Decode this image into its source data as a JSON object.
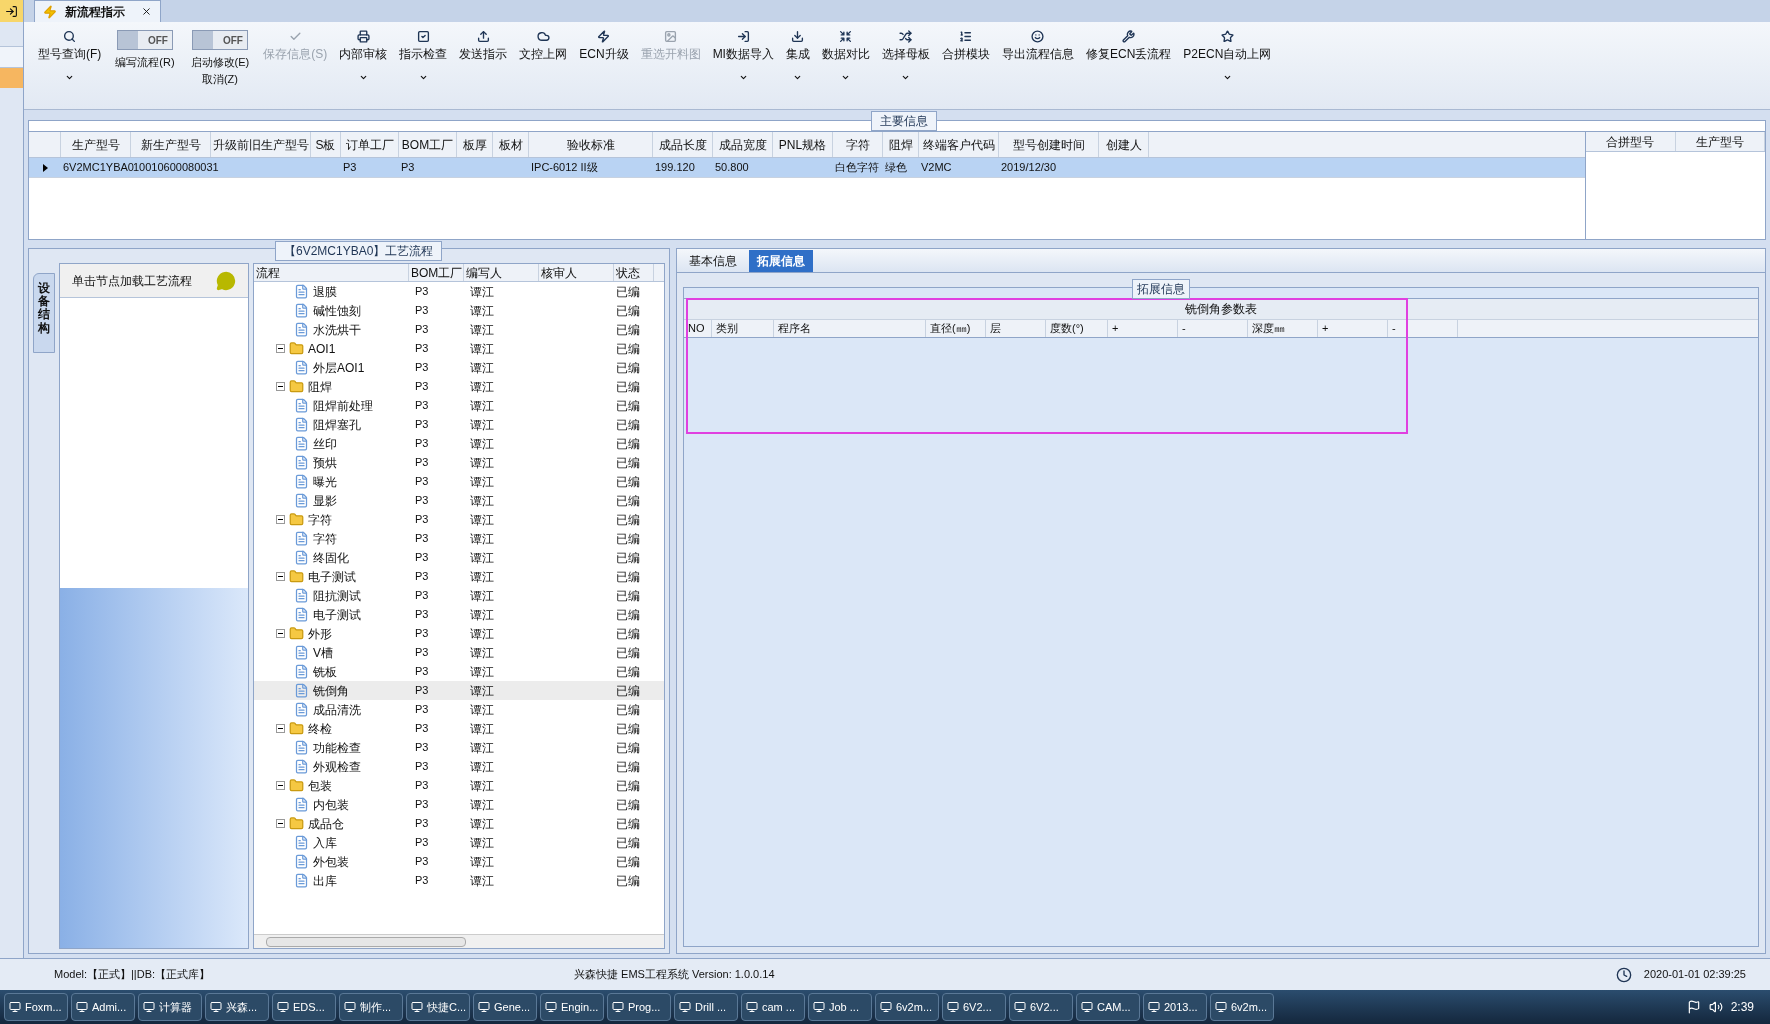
{
  "doc_tab": {
    "title": "新流程指示"
  },
  "toolbar": [
    {
      "kind": "button",
      "label": "型号查询(F)",
      "disabled": false,
      "dropdown": true
    },
    {
      "kind": "toggle",
      "label": "编写流程(R)",
      "switch_text": "OFF",
      "on": false
    },
    {
      "kind": "toggle",
      "label": "启动修改(E)",
      "sub_label": "取消(Z)",
      "switch_text": "OFF",
      "on": false
    },
    {
      "kind": "button",
      "label": "保存信息(S)",
      "disabled": true,
      "dropdown": false
    },
    {
      "kind": "button",
      "label": "内部审核",
      "disabled": false,
      "dropdown": true
    },
    {
      "kind": "button",
      "label": "指示检查",
      "disabled": false,
      "dropdown": true
    },
    {
      "kind": "button",
      "label": "发送指示",
      "disabled": false,
      "dropdown": false
    },
    {
      "kind": "button",
      "label": "文控上网",
      "disabled": false,
      "dropdown": false
    },
    {
      "kind": "button",
      "label": "ECN升级",
      "disabled": false,
      "dropdown": false
    },
    {
      "kind": "button",
      "label": "重选开料图",
      "disabled": true,
      "dropdown": false
    },
    {
      "kind": "button",
      "label": "MI数据导入",
      "disabled": false,
      "dropdown": true
    },
    {
      "kind": "button",
      "label": "集成",
      "disabled": false,
      "dropdown": true
    },
    {
      "kind": "button",
      "label": "数据对比",
      "disabled": false,
      "dropdown": true
    },
    {
      "kind": "button",
      "label": "选择母板",
      "disabled": false,
      "dropdown": true
    },
    {
      "kind": "button",
      "label": "合拼模块",
      "disabled": false,
      "dropdown": false
    },
    {
      "kind": "button",
      "label": "导出流程信息",
      "disabled": false,
      "dropdown": false
    },
    {
      "kind": "button",
      "label": "修复ECN丢流程",
      "disabled": false,
      "dropdown": false
    },
    {
      "kind": "button",
      "label": "P2ECN自动上网",
      "disabled": false,
      "dropdown": true
    }
  ],
  "main_info": {
    "title": "主要信息",
    "columns": [
      "生产型号",
      "新生产型号",
      "升级前旧生产型号",
      "S板",
      "订单工厂",
      "BOM工厂",
      "板厚",
      "板材",
      "验收标准",
      "成品长度",
      "成品宽度",
      "PNL规格",
      "字符",
      "阻焊",
      "终端客户代码",
      "型号创建时间",
      "创建人"
    ],
    "rows": [
      {
        "selected": true,
        "cells": [
          "6V2MC1YBA0",
          "10010600080031",
          "",
          "",
          "P3",
          "P3",
          "",
          "",
          "IPC-6012 II级",
          "199.120",
          "50.800",
          "",
          "白色字符",
          "绿色",
          "V2MC",
          "2019/12/30",
          ""
        ]
      }
    ],
    "side_columns": [
      "合拼型号",
      "生产型号"
    ]
  },
  "side_tab": {
    "label": "设备结构"
  },
  "node_panel": {
    "hint": "单击节点加载工艺流程"
  },
  "flow": {
    "title": "【6V2MC1YBA0】工艺流程",
    "columns": [
      "流程",
      "BOM工厂",
      "编写人",
      "核审人",
      "状态"
    ],
    "tree": [
      {
        "children": [
          {
            "label": "退膜",
            "bom": "P3",
            "writer": "谭江",
            "status": "已编",
            "selected": false
          },
          {
            "label": "碱性蚀刻",
            "bom": "P3",
            "writer": "谭江",
            "status": "已编",
            "selected": false
          },
          {
            "label": "水洗烘干",
            "bom": "P3",
            "writer": "谭江",
            "status": "已编",
            "selected": false
          }
        ]
      },
      {
        "label": "AOI1",
        "bom": "P3",
        "writer": "谭江",
        "status": "已编",
        "selected": false,
        "expanded": true,
        "children": [
          {
            "label": "外层AOI1",
            "bom": "P3",
            "writer": "谭江",
            "status": "已编",
            "selected": false
          }
        ]
      },
      {
        "label": "阻焊",
        "bom": "P3",
        "writer": "谭江",
        "status": "已编",
        "selected": false,
        "expanded": true,
        "children": [
          {
            "label": "阻焊前处理",
            "bom": "P3",
            "writer": "谭江",
            "status": "已编",
            "selected": false
          },
          {
            "label": "阻焊塞孔",
            "bom": "P3",
            "writer": "谭江",
            "status": "已编",
            "selected": false
          },
          {
            "label": "丝印",
            "bom": "P3",
            "writer": "谭江",
            "status": "已编",
            "selected": false
          },
          {
            "label": "预烘",
            "bom": "P3",
            "writer": "谭江",
            "status": "已编",
            "selected": false
          },
          {
            "label": "曝光",
            "bom": "P3",
            "writer": "谭江",
            "status": "已编",
            "selected": false
          },
          {
            "label": "显影",
            "bom": "P3",
            "writer": "谭江",
            "status": "已编",
            "selected": false
          }
        ]
      },
      {
        "label": "字符",
        "bom": "P3",
        "writer": "谭江",
        "status": "已编",
        "selected": false,
        "expanded": true,
        "children": [
          {
            "label": "字符",
            "bom": "P3",
            "writer": "谭江",
            "status": "已编",
            "selected": false
          },
          {
            "label": "终固化",
            "bom": "P3",
            "writer": "谭江",
            "status": "已编",
            "selected": false
          }
        ]
      },
      {
        "label": "电子测试",
        "bom": "P3",
        "writer": "谭江",
        "status": "已编",
        "selected": false,
        "expanded": true,
        "children": [
          {
            "label": "阻抗测试",
            "bom": "P3",
            "writer": "谭江",
            "status": "已编",
            "selected": false
          },
          {
            "label": "电子测试",
            "bom": "P3",
            "writer": "谭江",
            "status": "已编",
            "selected": false
          }
        ]
      },
      {
        "label": "外形",
        "bom": "P3",
        "writer": "谭江",
        "status": "已编",
        "selected": false,
        "expanded": true,
        "children": [
          {
            "label": "V槽",
            "bom": "P3",
            "writer": "谭江",
            "status": "已编",
            "selected": false
          },
          {
            "label": "铣板",
            "bom": "P3",
            "writer": "谭江",
            "status": "已编",
            "selected": false
          },
          {
            "label": "铣倒角",
            "bom": "P3",
            "writer": "谭江",
            "status": "已编",
            "selected": true
          },
          {
            "label": "成品清洗",
            "bom": "P3",
            "writer": "谭江",
            "status": "已编",
            "selected": false
          }
        ]
      },
      {
        "label": "终检",
        "bom": "P3",
        "writer": "谭江",
        "status": "已编",
        "selected": false,
        "expanded": true,
        "children": [
          {
            "label": "功能检查",
            "bom": "P3",
            "writer": "谭江",
            "status": "已编",
            "selected": false
          },
          {
            "label": "外观检查",
            "bom": "P3",
            "writer": "谭江",
            "status": "已编",
            "selected": false
          }
        ]
      },
      {
        "label": "包装",
        "bom": "P3",
        "writer": "谭江",
        "status": "已编",
        "selected": false,
        "expanded": true,
        "children": [
          {
            "label": "内包装",
            "bom": "P3",
            "writer": "谭江",
            "status": "已编",
            "selected": false
          }
        ]
      },
      {
        "label": "成品仓",
        "bom": "P3",
        "writer": "谭江",
        "status": "已编",
        "selected": false,
        "expanded": true,
        "children": [
          {
            "label": "入库",
            "bom": "P3",
            "writer": "谭江",
            "status": "已编",
            "selected": false
          },
          {
            "label": "外包装",
            "bom": "P3",
            "writer": "谭江",
            "status": "已编",
            "selected": false
          },
          {
            "label": "出库",
            "bom": "P3",
            "writer": "谭江",
            "status": "已编",
            "selected": false
          }
        ]
      }
    ]
  },
  "detail_tabs": [
    {
      "label": "基本信息",
      "selected": false
    },
    {
      "label": "拓展信息",
      "selected": true
    }
  ],
  "extension": {
    "title": "拓展信息",
    "table_title": "铣倒角参数表",
    "columns": [
      "NO",
      "类别",
      "程序名",
      "直径(㎜)",
      "层",
      "度数(°)",
      "+",
      "-",
      "深度㎜",
      "+",
      "-"
    ]
  },
  "status_bar": {
    "model": "Model:【正式】||DB:【正式库】",
    "app": "兴森快捷 EMS工程系统 Version: 1.0.0.14",
    "time": "2020-01-01 02:39:25"
  },
  "taskbar": {
    "items": [
      "Foxm...",
      "Admi...",
      "计算器",
      "兴森...",
      "EDS...",
      "制作...",
      "快捷C...",
      "Gene...",
      "Engin...",
      "Prog...",
      "Drill ...",
      "cam ...",
      "Job ...",
      "6v2m...",
      "6V2...",
      "6V2...",
      "CAM...",
      "2013...",
      "6v2m..."
    ],
    "clock": "2:39"
  }
}
